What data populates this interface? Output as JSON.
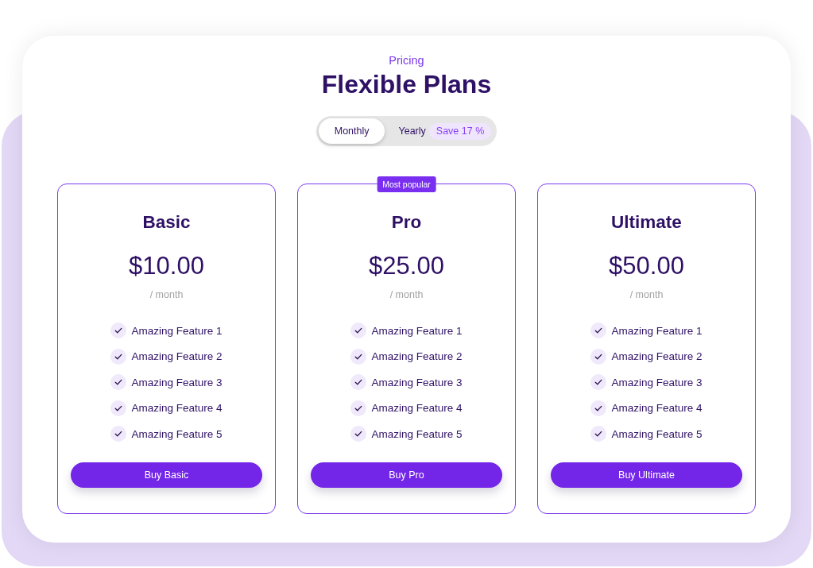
{
  "header": {
    "eyebrow": "Pricing",
    "title": "Flexible Plans"
  },
  "billing_toggle": {
    "options": [
      {
        "label": "Monthly",
        "selected": true
      },
      {
        "label": "Yearly",
        "selected": false,
        "tag": "Save 17 %"
      }
    ]
  },
  "plans": [
    {
      "name": "Basic",
      "price": "$10.00",
      "period": "/ month",
      "features": [
        "Amazing Feature 1",
        "Amazing Feature 2",
        "Amazing Feature 3",
        "Amazing Feature 4",
        "Amazing Feature 5"
      ],
      "button": "Buy Basic"
    },
    {
      "badge": "Most popular",
      "name": "Pro",
      "price": "$25.00",
      "period": "/ month",
      "features": [
        "Amazing Feature 1",
        "Amazing Feature 2",
        "Amazing Feature 3",
        "Amazing Feature 4",
        "Amazing Feature 5"
      ],
      "button": "Buy Pro"
    },
    {
      "name": "Ultimate",
      "price": "$50.00",
      "period": "/ month",
      "features": [
        "Amazing Feature 1",
        "Amazing Feature 2",
        "Amazing Feature 3",
        "Amazing Feature 4",
        "Amazing Feature 5"
      ],
      "button": "Buy Ultimate"
    }
  ]
}
